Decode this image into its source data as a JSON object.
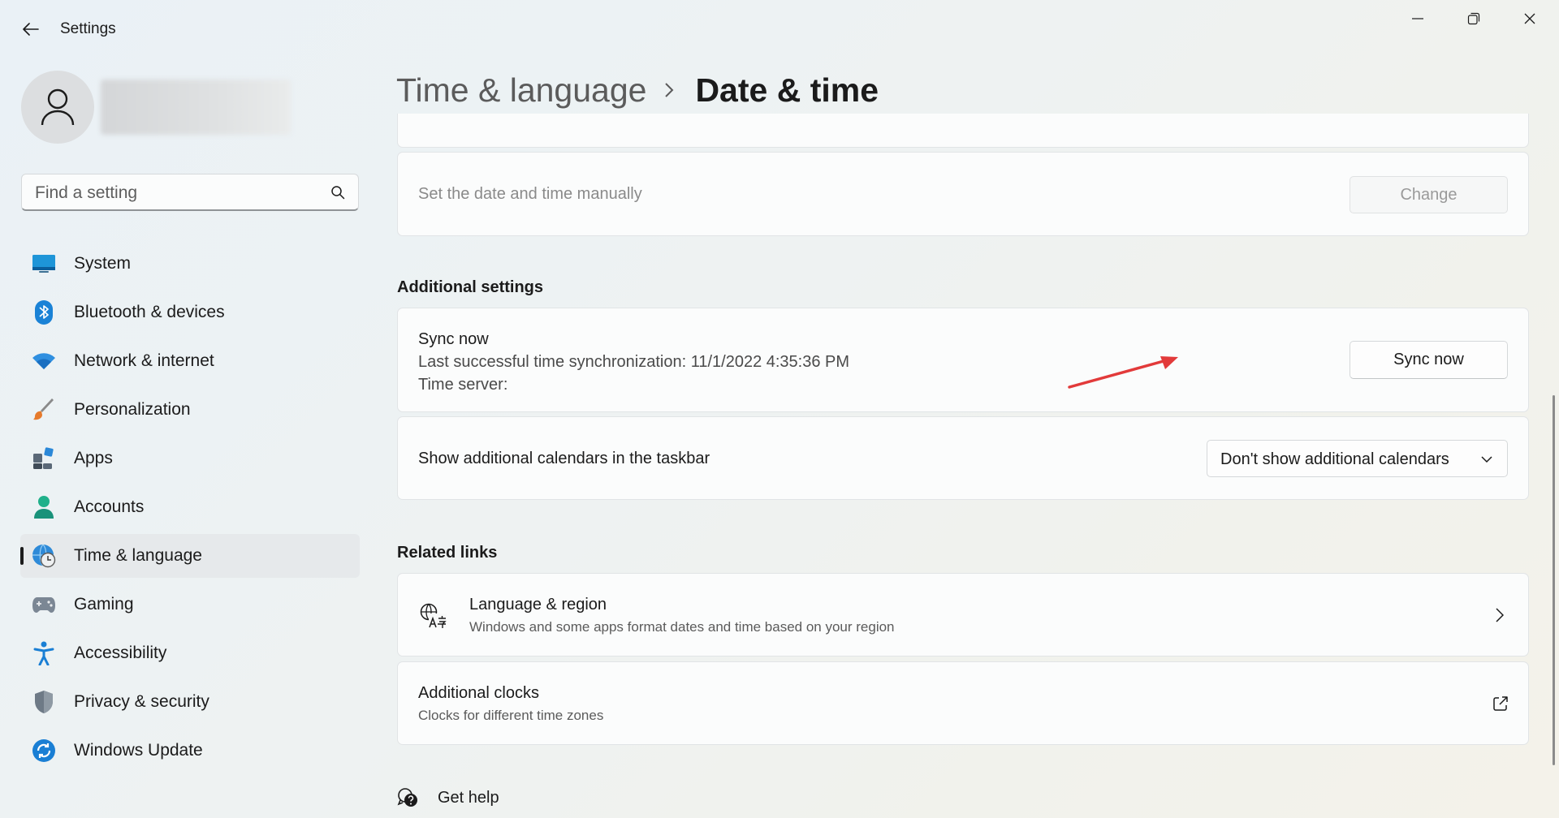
{
  "window": {
    "title": "Settings",
    "controls": [
      "minimize-icon",
      "restore-icon",
      "close-icon"
    ]
  },
  "search": {
    "placeholder": "Find a setting"
  },
  "sidebar": {
    "items": [
      {
        "label": "System",
        "icon": "system-icon"
      },
      {
        "label": "Bluetooth & devices",
        "icon": "bluetooth-icon"
      },
      {
        "label": "Network & internet",
        "icon": "wifi-icon"
      },
      {
        "label": "Personalization",
        "icon": "brush-icon"
      },
      {
        "label": "Apps",
        "icon": "apps-icon"
      },
      {
        "label": "Accounts",
        "icon": "accounts-icon"
      },
      {
        "label": "Time & language",
        "icon": "globe-clock-icon",
        "active": true
      },
      {
        "label": "Gaming",
        "icon": "gamepad-icon"
      },
      {
        "label": "Accessibility",
        "icon": "accessibility-icon"
      },
      {
        "label": "Privacy & security",
        "icon": "shield-icon"
      },
      {
        "label": "Windows Update",
        "icon": "update-icon"
      }
    ]
  },
  "header": {
    "parent": "Time & language",
    "current": "Date & time"
  },
  "manual": {
    "label": "Set the date and time manually",
    "button": "Change"
  },
  "additional_settings": {
    "title": "Additional settings",
    "sync": {
      "title": "Sync now",
      "last_sync": "Last successful time synchronization: 11/1/2022 4:35:36 PM",
      "server": "Time server:",
      "button": "Sync now"
    },
    "calendars": {
      "label": "Show additional calendars in the taskbar",
      "selected": "Don't show additional calendars"
    }
  },
  "related_links": {
    "title": "Related links",
    "language_region": {
      "title": "Language & region",
      "subtitle": "Windows and some apps format dates and time based on your region"
    },
    "additional_clocks": {
      "title": "Additional clocks",
      "subtitle": "Clocks for different time zones"
    }
  },
  "help": {
    "label": "Get help"
  },
  "colors": {
    "accent": "#0067c0",
    "annotation_arrow": "#e23a3a"
  }
}
